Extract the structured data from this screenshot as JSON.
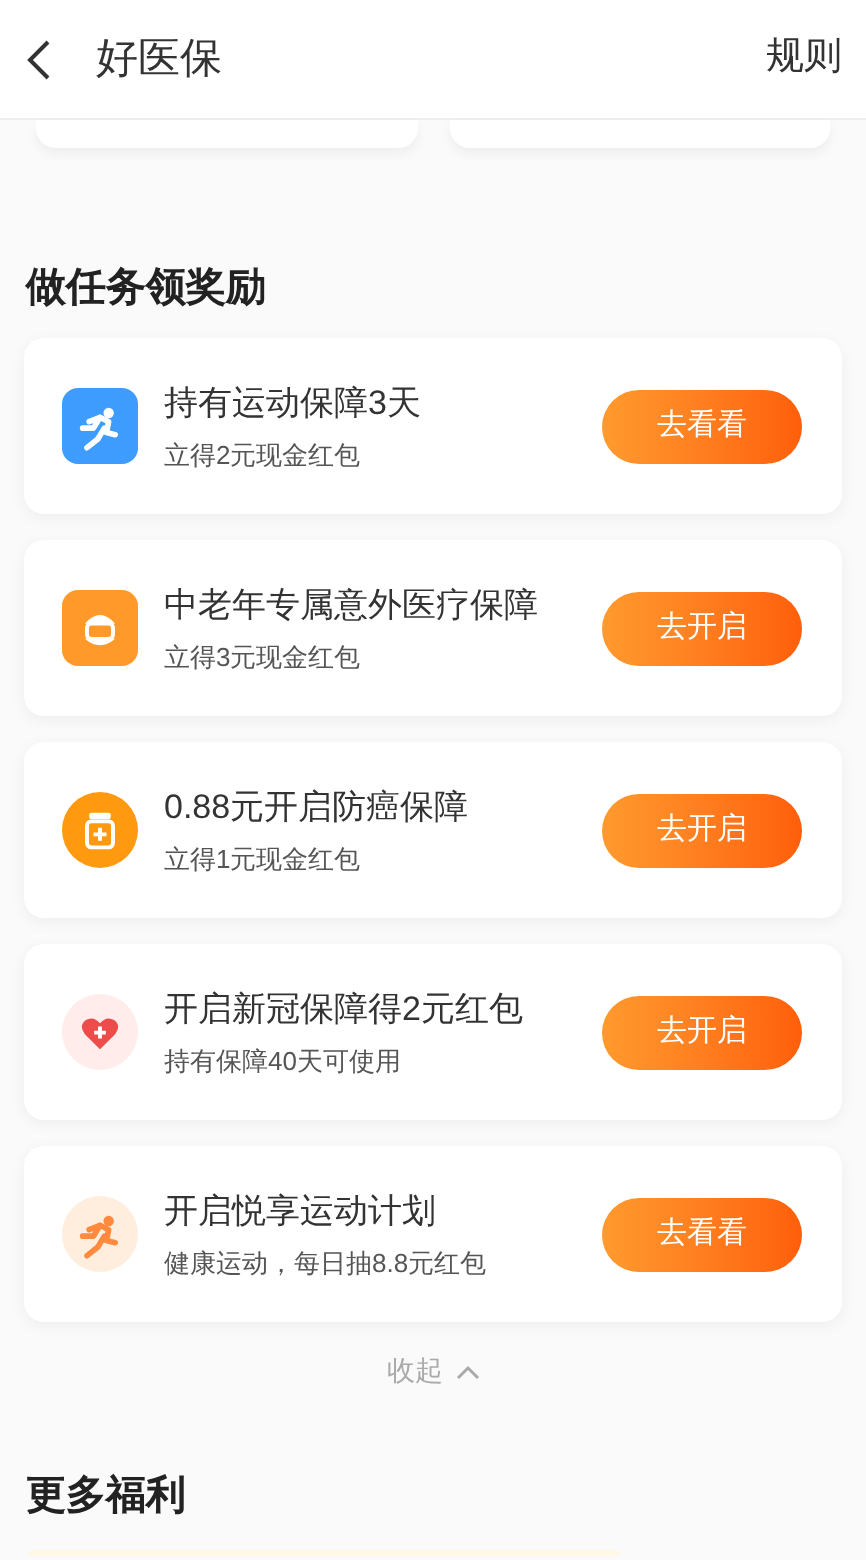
{
  "header": {
    "title": "好医保",
    "action": "规则"
  },
  "tasks_section": {
    "title": "做任务领奖励"
  },
  "tasks": [
    {
      "title": "持有运动保障3天",
      "subtitle": "立得2元现金红包",
      "button": "去看看"
    },
    {
      "title": "中老年专属意外医疗保障",
      "subtitle": "立得3元现金红包",
      "button": "去开启"
    },
    {
      "title": "0.88元开启防癌保障",
      "subtitle": "立得1元现金红包",
      "button": "去开启"
    },
    {
      "title": "开启新冠保障得2元红包",
      "subtitle": "持有保障40天可使用",
      "button": "去开启"
    },
    {
      "title": "开启悦享运动计划",
      "subtitle": "健康运动，每日抽8.8元红包",
      "button": "去看看"
    }
  ],
  "collapse": {
    "label": "收起",
    "expanded": true
  },
  "more_section": {
    "title": "更多福利"
  }
}
